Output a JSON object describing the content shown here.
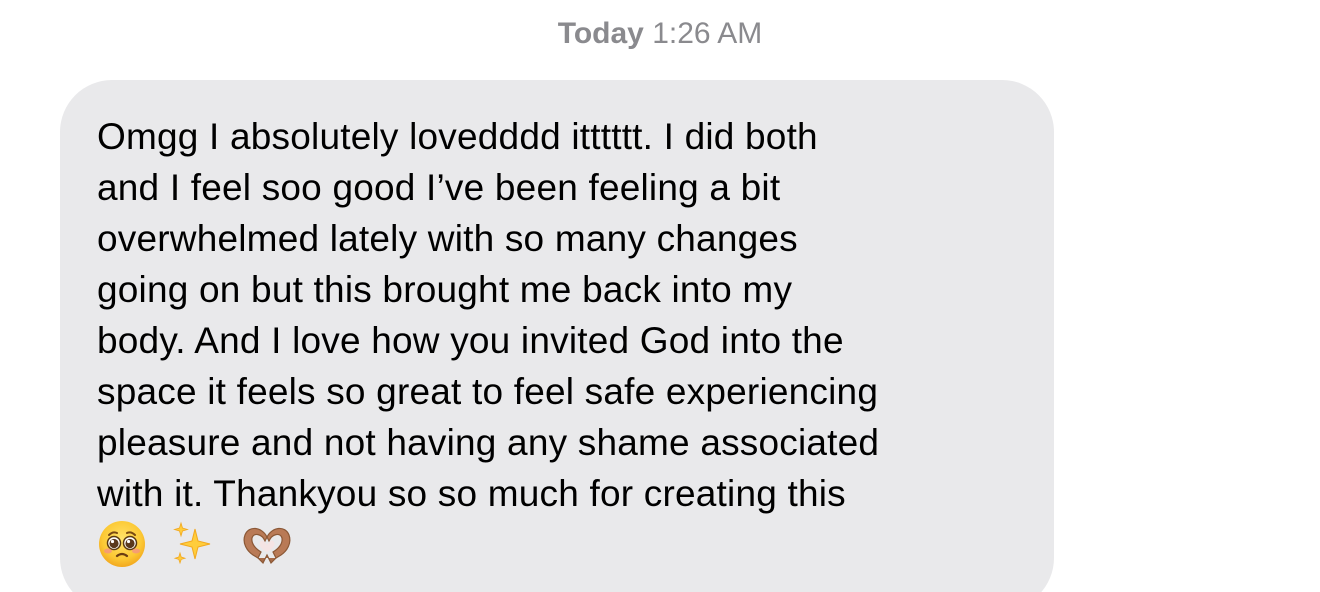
{
  "conversation": {
    "timestamp_day": "Today",
    "timestamp_time": "1:26 AM"
  },
  "message": {
    "lines": [
      "Omgg I absolutely lovedddd itttttt. I did both",
      "and I feel soo good I’ve been feeling a bit",
      "overwhelmed lately with so many changes",
      "going on but this brought me back into my",
      "body. And I love how you invited God into the",
      "space it feels so great to feel safe experiencing",
      "pleasure and not having any shame associated",
      "with it. Thankyou so so much for creating this"
    ],
    "emojis": [
      "pleading-face-icon",
      "sparkles-icon",
      "heart-hands-icon"
    ],
    "bubble_color": "#e9e9eb",
    "text_color": "#000000"
  }
}
